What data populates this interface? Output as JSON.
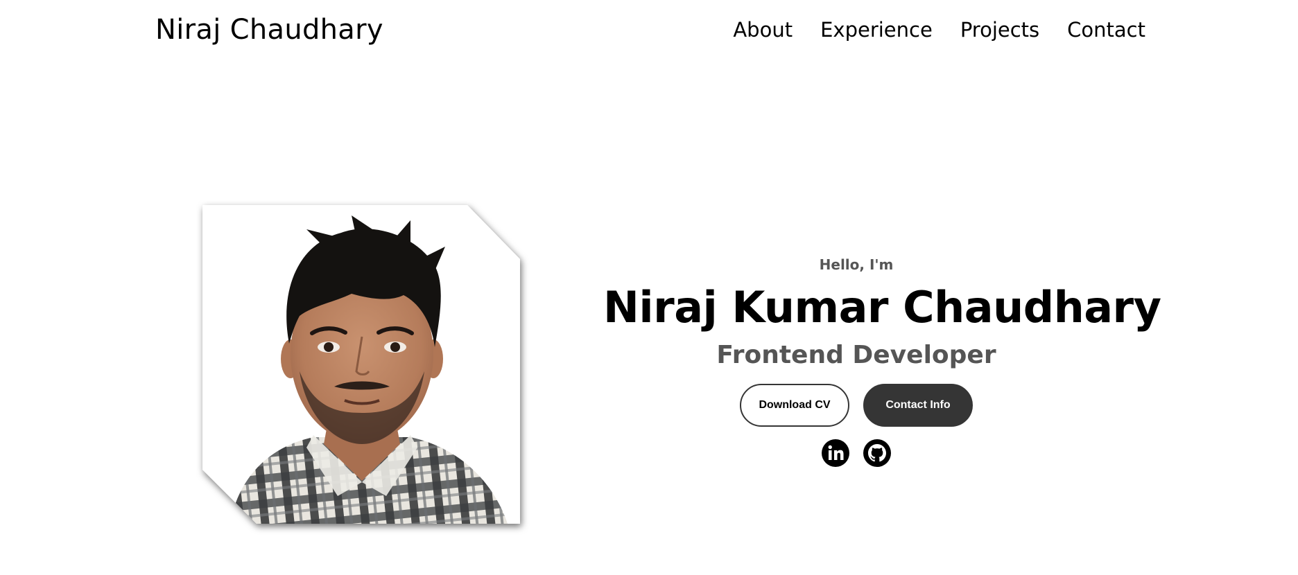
{
  "header": {
    "logo": "Niraj Chaudhary",
    "nav": [
      {
        "label": "About"
      },
      {
        "label": "Experience"
      },
      {
        "label": "Projects"
      },
      {
        "label": "Contact"
      }
    ]
  },
  "hero": {
    "greeting": "Hello, I'm",
    "name": "Niraj Kumar Chaudhary",
    "role": "Frontend Developer",
    "buttons": {
      "download": "Download CV",
      "contact": "Contact Info"
    },
    "socials": [
      {
        "icon": "linkedin-icon"
      },
      {
        "icon": "github-icon"
      }
    ]
  },
  "colors": {
    "text": "#000000",
    "muted": "#555555",
    "button_dark": "#353535",
    "background": "#ffffff"
  }
}
